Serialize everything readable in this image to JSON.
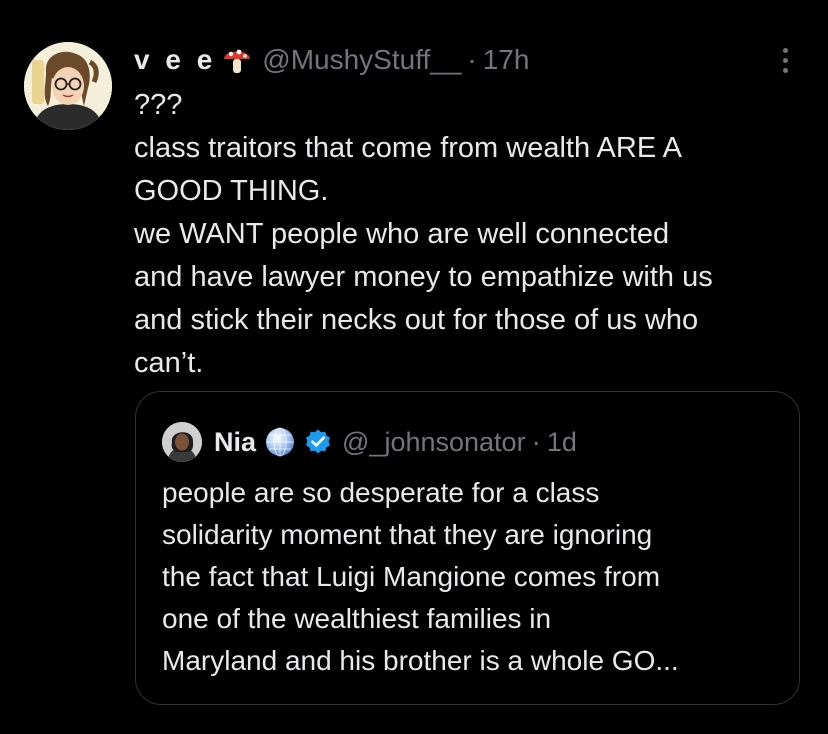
{
  "tweet": {
    "display_name": "v e e",
    "emoji_icon": "mushroom-icon",
    "handle": "@MushyStuff__",
    "separator": "·",
    "time": "17h",
    "body_lines": [
      "???",
      "class traitors that come from wealth ARE A",
      "GOOD THING.",
      "we WANT people who are well connected",
      "and have lawyer money to empathize with us",
      "and stick their necks out for those of us who",
      "can’t."
    ]
  },
  "quote": {
    "display_name": "Nia",
    "badge_icons": [
      "globe-icon",
      "verified-badge-icon"
    ],
    "handle": "@_johnsonator",
    "separator": "·",
    "time": "1d",
    "body_lines": [
      "people are so desperate for a class",
      "solidarity moment that they are ignoring",
      "the fact that Luigi Mangione comes from",
      "one of the wealthiest families in",
      "Maryland and his brother is a whole GO..."
    ]
  },
  "colors": {
    "background": "#000000",
    "text_primary": "#e7e9ea",
    "text_secondary": "#71767b",
    "border": "#2f3336",
    "verified_blue": "#1d9bf0"
  }
}
